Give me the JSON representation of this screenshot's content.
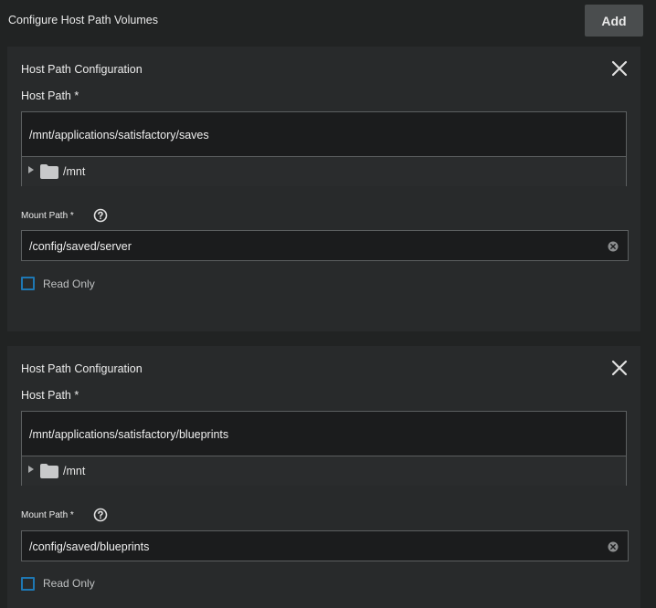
{
  "header": {
    "title": "Configure Host Path Volumes",
    "add_label": "Add"
  },
  "volumes": [
    {
      "card_title": "Host Path Configuration",
      "host_path_label": "Host Path *",
      "host_path_value": "/mnt/applications/satisfactory/saves",
      "tree_root": "/mnt",
      "mount_path_label": "Mount Path *",
      "mount_path_value": "/config/saved/server",
      "read_only_label": "Read Only",
      "read_only_checked": false
    },
    {
      "card_title": "Host Path Configuration",
      "host_path_label": "Host Path *",
      "host_path_value": "/mnt/applications/satisfactory/blueprints",
      "tree_root": "/mnt",
      "mount_path_label": "Mount Path *",
      "mount_path_value": "/config/saved/blueprints",
      "read_only_label": "Read Only",
      "read_only_checked": false
    }
  ],
  "icons": {
    "close": "close-icon",
    "help": "help-circle-icon",
    "clear": "clear-icon",
    "folder": "folder-icon",
    "expand": "chevron-right-icon"
  },
  "colors": {
    "background": "#212323",
    "card": "#282a2b",
    "input_bg": "#1b1c1d",
    "border": "#5c5f60",
    "checkbox_accent": "#1e78b4",
    "button": "#4a4d4e"
  }
}
